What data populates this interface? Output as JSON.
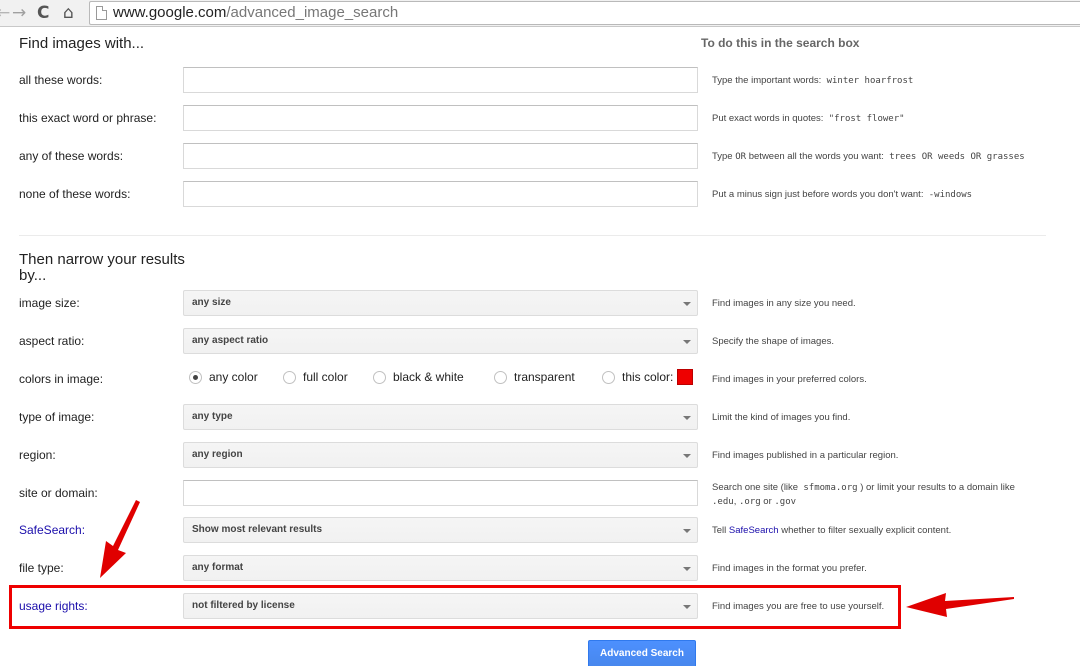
{
  "browser": {
    "url_host": "www.google.com",
    "url_path": "/advanced_image_search",
    "back_glyph": "←",
    "forward_glyph": "→",
    "reload_glyph": "C",
    "home_glyph": "⌂"
  },
  "headings": {
    "find": "Find images with...",
    "todo": "To do this in the search box",
    "narrow": "Then narrow your results by..."
  },
  "find_rows": [
    {
      "label": "all these words:",
      "hint_prefix": "Type the important words:",
      "hint_code": "winter hoarfrost"
    },
    {
      "label": "this exact word or phrase:",
      "hint_prefix": "Put exact words in quotes:",
      "hint_code": "\"frost flower\""
    },
    {
      "label": "any of these words:",
      "hint_prefix": "Type",
      "hint_or": "OR",
      "hint_mid": "between all the words you want:",
      "hint_code": "trees OR weeds OR grasses"
    },
    {
      "label": "none of these words:",
      "hint_prefix": "Put a minus sign just before words you don't want:",
      "hint_code": "-windows"
    }
  ],
  "narrow_rows": {
    "image_size": {
      "label": "image size:",
      "value": "any size",
      "hint": "Find images in any size you need."
    },
    "aspect_ratio": {
      "label": "aspect ratio:",
      "value": "any aspect ratio",
      "hint": "Specify the shape of images."
    },
    "colors": {
      "label": "colors in image:",
      "options": [
        "any color",
        "full color",
        "black & white",
        "transparent",
        "this color:"
      ],
      "selected": "any color",
      "swatch_color": "#ee0000",
      "hint": "Find images in your preferred colors."
    },
    "type": {
      "label": "type of image:",
      "value": "any type",
      "hint": "Limit the kind of images you find."
    },
    "region": {
      "label": "region:",
      "value": "any region",
      "hint": "Find images published in a particular region."
    },
    "site": {
      "label": "site or domain:",
      "hint_line1_prefix": "Search one site (like",
      "hint_line1_code": "sfmoma.org",
      "hint_line1_suffix": ") or limit your results to a domain like",
      "hint_line2_code1": ".edu",
      "hint_line2_sep1": ",",
      "hint_line2_code2": ".org",
      "hint_line2_or": "or",
      "hint_line2_code3": ".gov"
    },
    "safesearch": {
      "label": "SafeSearch:",
      "value": "Show most relevant results",
      "hint_prefix": "Tell",
      "hint_link": "SafeSearch",
      "hint_suffix": "whether to filter sexually explicit content."
    },
    "file_type": {
      "label": "file type:",
      "value": "any format",
      "hint": "Find images in the format you prefer."
    },
    "usage_rights": {
      "label": "usage rights:",
      "value": "not filtered by license",
      "hint": "Find images you are free to use yourself."
    }
  },
  "button": {
    "label": "Advanced Search"
  },
  "annotation": {
    "color": "#e00000"
  }
}
